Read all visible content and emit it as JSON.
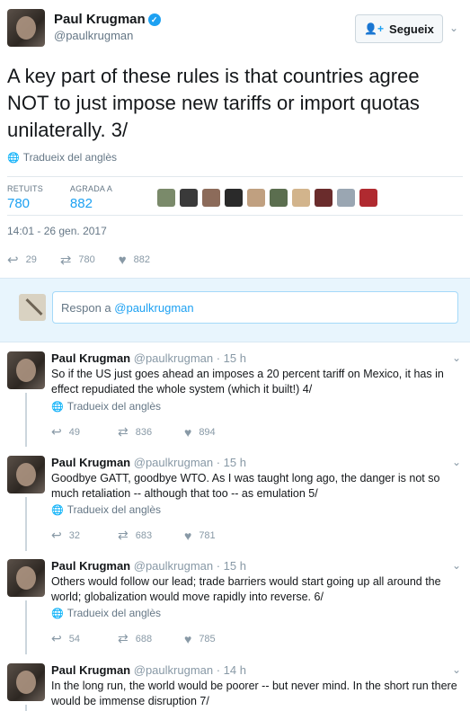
{
  "main_tweet": {
    "name": "Paul Krugman",
    "handle": "@paulkrugman",
    "follow_label": "Segueix",
    "text": "A key part of these rules is that countries agree NOT to just impose new tariffs or import quotas unilaterally. 3/",
    "translate": "Tradueix del anglès",
    "retweets_label": "RETUITS",
    "retweets": "780",
    "likes_label": "AGRADA A",
    "likes": "882",
    "timestamp": "14:01 - 26 gen. 2017",
    "replies": "29",
    "retweet_count": "780",
    "like_count": "882",
    "face_colors": [
      "#7a8a6a",
      "#3a3a3a",
      "#8c6b5a",
      "#2a2a2a",
      "#c0a080",
      "#5b6e4f",
      "#d2b48c",
      "#6a2c2c",
      "#9aa6b2",
      "#b02a30"
    ]
  },
  "reply_box": {
    "prefix": "Respon a ",
    "handle": "@paulkrugman"
  },
  "replies": [
    {
      "name": "Paul Krugman",
      "meta": "@paulkrugman · 15 h",
      "text": "So if the US just goes ahead an imposes a 20 percent tariff on Mexico, it has in effect repudiated the whole system (which it built!) 4/",
      "translate": "Tradueix del anglès",
      "replies": "49",
      "retweets": "836",
      "likes": "894"
    },
    {
      "name": "Paul Krugman",
      "meta": "@paulkrugman · 15 h",
      "text": "Goodbye GATT, goodbye WTO. As I was taught long ago, the danger is not so much retaliation -- although that too -- as emulation 5/",
      "translate": "Tradueix del anglès",
      "replies": "32",
      "retweets": "683",
      "likes": "781"
    },
    {
      "name": "Paul Krugman",
      "meta": "@paulkrugman · 15 h",
      "text": "Others would follow our lead; trade barriers would start going up all around the world; globalization would move rapidly into reverse. 6/",
      "translate": "Tradueix del anglès",
      "replies": "54",
      "retweets": "688",
      "likes": "785"
    },
    {
      "name": "Paul Krugman",
      "meta": "@paulkrugman · 14 h",
      "text": "In the long run, the world would be poorer -- but never mind. In the short run there would be immense disruption 7/"
    }
  ],
  "colors": {
    "accent": "#1da1f2",
    "muted": "#657786",
    "reply_bg": "#e8f5fd"
  }
}
